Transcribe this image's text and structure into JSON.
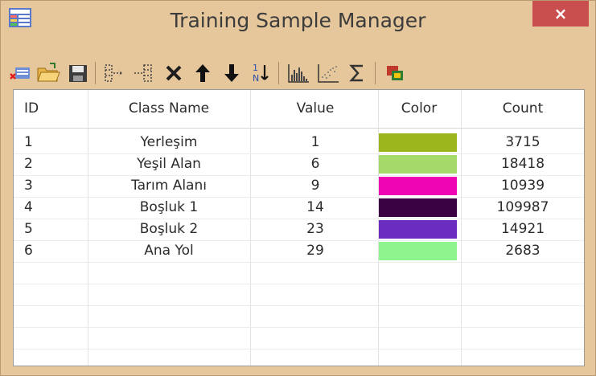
{
  "window": {
    "title": "Training Sample Manager",
    "close_label": "×",
    "icon": "table-icon"
  },
  "toolbar": {
    "buttons": [
      {
        "name": "remove-sample-icon"
      },
      {
        "name": "open-folder-icon"
      },
      {
        "name": "save-icon"
      },
      {
        "name": "merge-classes-icon"
      },
      {
        "name": "split-class-icon"
      },
      {
        "name": "delete-icon"
      },
      {
        "name": "move-up-icon"
      },
      {
        "name": "move-down-icon"
      },
      {
        "name": "sort-icon"
      },
      {
        "name": "histogram-icon"
      },
      {
        "name": "scatterplot-icon"
      },
      {
        "name": "sigma-icon"
      },
      {
        "name": "color-tool-icon"
      }
    ]
  },
  "table": {
    "headers": {
      "id": "ID",
      "class_name": "Class Name",
      "value": "Value",
      "color": "Color",
      "count": "Count"
    },
    "rows": [
      {
        "id": "1",
        "class_name": "Yerleşim",
        "value": "1",
        "color": "#9cb61e",
        "count": "3715"
      },
      {
        "id": "2",
        "class_name": "Yeşil Alan",
        "value": "6",
        "color": "#a5da6b",
        "count": "18418"
      },
      {
        "id": "3",
        "class_name": "Tarım Alanı",
        "value": "9",
        "color": "#ee06b4",
        "count": "10939"
      },
      {
        "id": "4",
        "class_name": "Boşluk 1",
        "value": "14",
        "color": "#3b0243",
        "count": "109987"
      },
      {
        "id": "5",
        "class_name": "Boşluk 2",
        "value": "23",
        "color": "#6b2cc2",
        "count": "14921"
      },
      {
        "id": "6",
        "class_name": "Ana Yol",
        "value": "29",
        "color": "#8ef48d",
        "count": "2683"
      }
    ]
  }
}
